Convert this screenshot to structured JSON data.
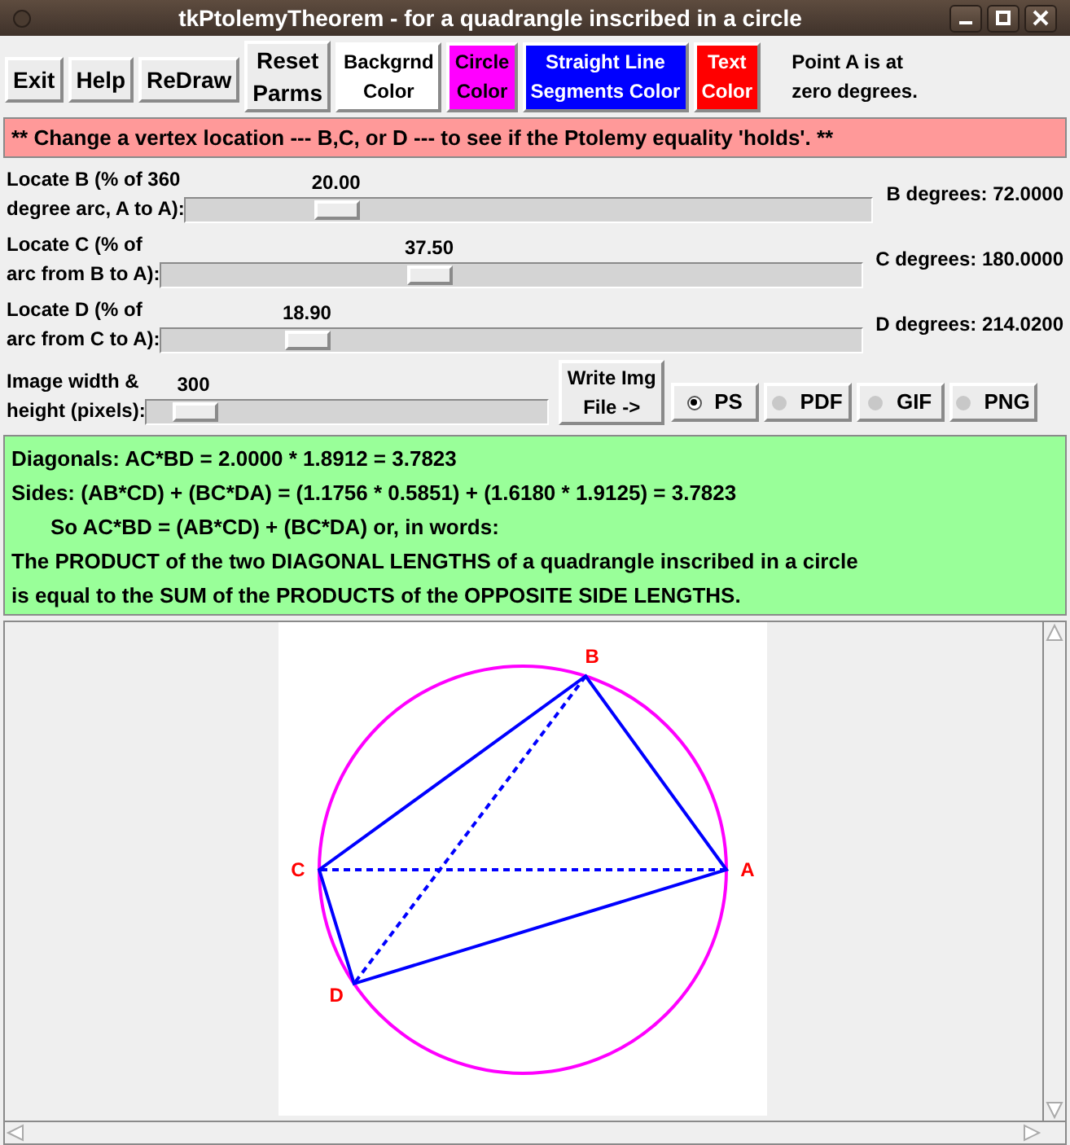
{
  "window": {
    "title": "tkPtolemyTheorem - for a quadrangle inscribed in a circle"
  },
  "toolbar": {
    "buttons": [
      {
        "label": "Exit"
      },
      {
        "label": "Help"
      },
      {
        "label": "ReDraw"
      },
      {
        "label": "Reset\nParms"
      }
    ],
    "color_buttons": [
      {
        "label": "Backgrnd\nColor",
        "color": "#ffffff"
      },
      {
        "label": "Circle\nColor",
        "color": "#ff00ff"
      },
      {
        "label": "Straight Line\nSegments Color",
        "color": "#0000ff"
      },
      {
        "label": "Text\nColor",
        "color": "#ff0000"
      }
    ],
    "note": "Point A is at\nzero degrees."
  },
  "banner": "** Change a vertex location --- B,C, or D --- to see if the Ptolemy equality 'holds'. **",
  "sliders": [
    {
      "label": "Locate B (% of 360\ndegree arc, A to A):",
      "value": "20.00",
      "level": 0.2,
      "reading": "B degrees: 72.0000"
    },
    {
      "label": "Locate C (% of\narc from B to A):",
      "value": "37.50",
      "level": 0.375,
      "reading": "C degrees: 180.0000"
    },
    {
      "label": "Locate D (% of\narc from C to A):",
      "value": "18.90",
      "level": 0.189,
      "reading": "D degrees: 214.0200"
    }
  ],
  "image_size": {
    "label": "Image width &\nheight (pixels):",
    "value": "300",
    "level": 0.07
  },
  "write_button": "Write Img\nFile ->",
  "formats": [
    {
      "label": "PS",
      "selected": true
    },
    {
      "label": "PDF",
      "selected": false
    },
    {
      "label": "GIF",
      "selected": false
    },
    {
      "label": "PNG",
      "selected": false
    }
  ],
  "results": [
    {
      "text": "Diagonals: AC*BD = 2.0000 * 1.8912 = 3.7823",
      "indented": false
    },
    {
      "text": "Sides: (AB*CD) + (BC*DA) = (1.1756 * 0.5851) + (1.6180 * 1.9125) = 3.7823",
      "indented": false
    },
    {
      "text": "So AC*BD = (AB*CD) + (BC*DA) or, in words:",
      "indented": true
    },
    {
      "text": "The PRODUCT of the two DIAGONAL LENGTHS of a quadrangle inscribed in a circle",
      "indented": false
    },
    {
      "text": "is equal to the SUM of the PRODUCTS of the OPPOSITE SIDE LENGTHS.",
      "indented": false
    }
  ],
  "diagram": {
    "vertices": [
      {
        "label": "A"
      },
      {
        "label": "B"
      },
      {
        "label": "C"
      },
      {
        "label": "D"
      }
    ]
  }
}
